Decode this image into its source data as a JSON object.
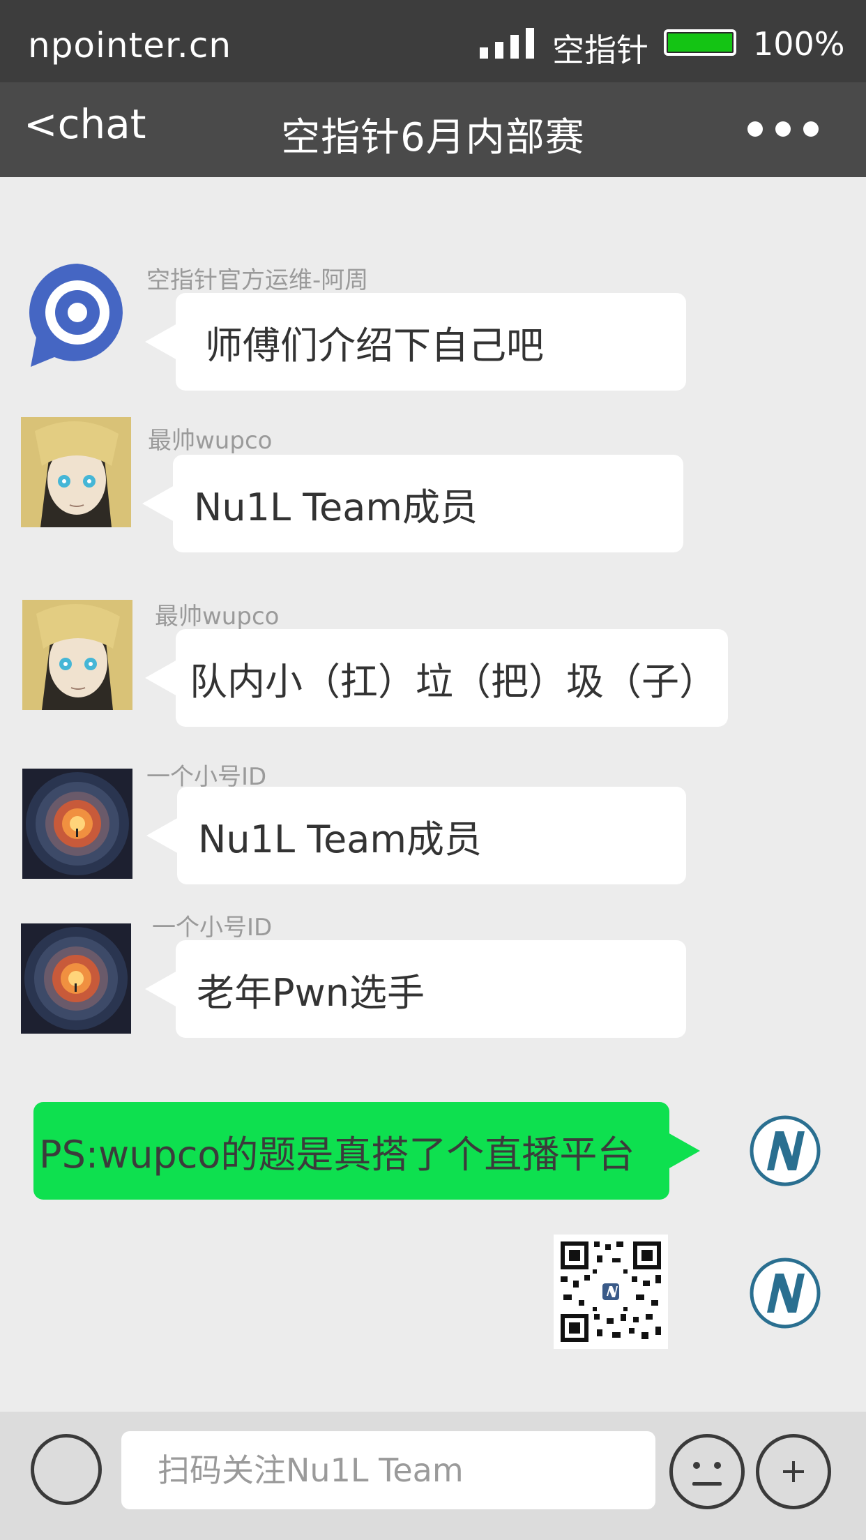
{
  "status_bar": {
    "site": "npointer.cn",
    "carrier": "空指针",
    "battery": "100%",
    "battery_level": 1.0,
    "battery_color": "#14c414"
  },
  "nav": {
    "back": "<chat",
    "title": "空指针6月内部赛",
    "more_icon": "more-dots-icon"
  },
  "messages": [
    {
      "sender": "空指针官方运维-阿周",
      "text": "师傅们介绍下自己吧",
      "avatar": "npointer-logo"
    },
    {
      "sender": "最帅wupco",
      "text": "Nu1L Team成员",
      "avatar": "anime-girl-avatar"
    },
    {
      "sender": "最帅wupco",
      "text": "队内小（扛）垃（把）圾（子）",
      "avatar": "anime-girl-avatar"
    },
    {
      "sender": "一个小号ID",
      "text": "Nu1L Team成员",
      "avatar": "vortex-avatar"
    },
    {
      "sender": "一个小号ID",
      "text": "老年Pwn选手",
      "avatar": "vortex-avatar"
    },
    {
      "sender": "",
      "text": "PS:wupco的题是真搭了个直播平台",
      "avatar": "nu1l-logo",
      "self": true
    },
    {
      "sender": "",
      "text": "",
      "avatar": "nu1l-logo",
      "self": true,
      "image": "qr-code"
    }
  ],
  "input": {
    "placeholder": "扫码关注Nu1L Team"
  },
  "colors": {
    "self_bubble": "#0ee04f",
    "other_bubble": "#ffffff",
    "bar": "#3d3d3d"
  }
}
